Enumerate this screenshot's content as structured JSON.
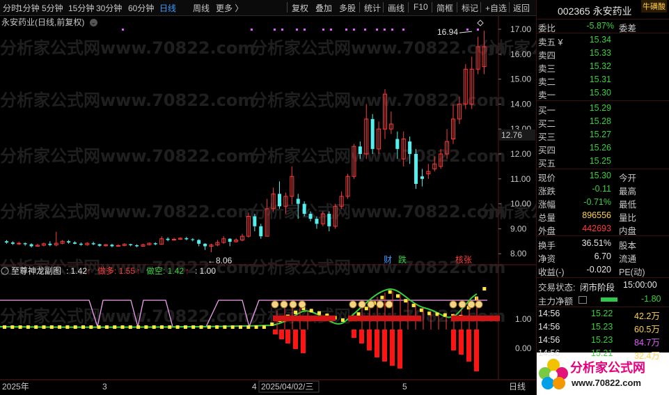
{
  "toolbar": {
    "items": [
      "分时",
      "1分钟",
      "5分钟",
      "15分钟",
      "30分钟",
      "60分钟",
      "日线",
      "周线",
      "更多 〉",
      "复权",
      "叠加",
      "多股",
      "统计",
      "画线",
      "F10",
      "简框",
      "标记",
      "+自选",
      "返回"
    ],
    "active": "日线"
  },
  "chart": {
    "title": "永安药业(日线,前复权)",
    "y_labels": [
      "17.00",
      "16.00",
      "15.00",
      "14.00",
      "13.00",
      "12.00",
      "11.00",
      "10.00",
      "9.00",
      "8.00"
    ],
    "crosshair_price": "12.76",
    "high_annotation": "16.94",
    "low_annotation": "←8.06",
    "event_tags": [
      "财",
      "跌",
      "核张"
    ],
    "watermark": "分析家公式网www.70822.com"
  },
  "sub_chart": {
    "name": "至尊神龙副图",
    "value": ": 1.42",
    "arrow": "↑",
    "long_label": "做多: 1.55",
    "short_label": "做空: 1.42",
    "third_value": ": 1.00",
    "y_labels": [
      "1.00",
      "0.00"
    ]
  },
  "x_axis": {
    "labels": [
      "2025年",
      "3",
      "4",
      "2025/04/02/三",
      "5"
    ],
    "corner": "日线"
  },
  "quote": {
    "code": "002365",
    "name": "永安药业",
    "badge": "牛磺酸",
    "weibi_label": "委比",
    "weibi": "-5.87%",
    "weicha_label": "委差",
    "asks": [
      {
        "label": "卖五 ¥",
        "price": "15.34"
      },
      {
        "label": "卖四",
        "price": "15.33"
      },
      {
        "label": "卖三",
        "price": "15.32"
      },
      {
        "label": "卖二",
        "price": "15.31"
      },
      {
        "label": "卖一",
        "price": "15.30"
      }
    ],
    "bids": [
      {
        "label": "买一",
        "price": "15.29"
      },
      {
        "label": "买二",
        "price": "15.28"
      },
      {
        "label": "买三",
        "price": "15.27"
      },
      {
        "label": "买四",
        "price": "15.26"
      },
      {
        "label": "买五",
        "price": "15.25"
      }
    ],
    "stats": [
      {
        "label": "现价",
        "value": "15.30",
        "label2": "今开",
        "color": "g"
      },
      {
        "label": "涨跌",
        "value": "-0.11",
        "label2": "最高",
        "color": "g"
      },
      {
        "label": "涨幅",
        "value": "-0.71%",
        "label2": "最低",
        "color": "g"
      },
      {
        "label": "总量",
        "value": "896556",
        "label2": "量比",
        "color": "y"
      },
      {
        "label": "外盘",
        "value": "442693",
        "label2": "内盘",
        "color": "r"
      }
    ],
    "stats2": [
      {
        "label": "换手",
        "value": "36.51%",
        "label2": "股本",
        "color": "w"
      },
      {
        "label": "净资",
        "value": "6.70",
        "label2": "流通",
        "color": "w"
      },
      {
        "label": "收益(-)",
        "value": "-0.020",
        "label2": "PE(动)",
        "color": "w"
      }
    ],
    "trade_status_label": "交易状态:",
    "trade_status": "闭市阶段",
    "trade_time": "15:00:00",
    "main_flow_label": "主力净额",
    "main_flow_value": "-1.80",
    "ticks": [
      {
        "time": "14:56",
        "price": "15.22",
        "vol": "42.2万",
        "volcolor": "y"
      },
      {
        "time": "14:56",
        "price": "15.23",
        "vol": "60.5万",
        "volcolor": "y"
      },
      {
        "time": "14:56",
        "price": "15.23",
        "vol": "84.7万",
        "volcolor": "m"
      },
      {
        "time": "14:56",
        "price": "15.21",
        "vol": "32.4万",
        "volcolor": "y"
      }
    ],
    "logo_text": "分析家公式网",
    "logo_url": "www.70822.com"
  }
}
